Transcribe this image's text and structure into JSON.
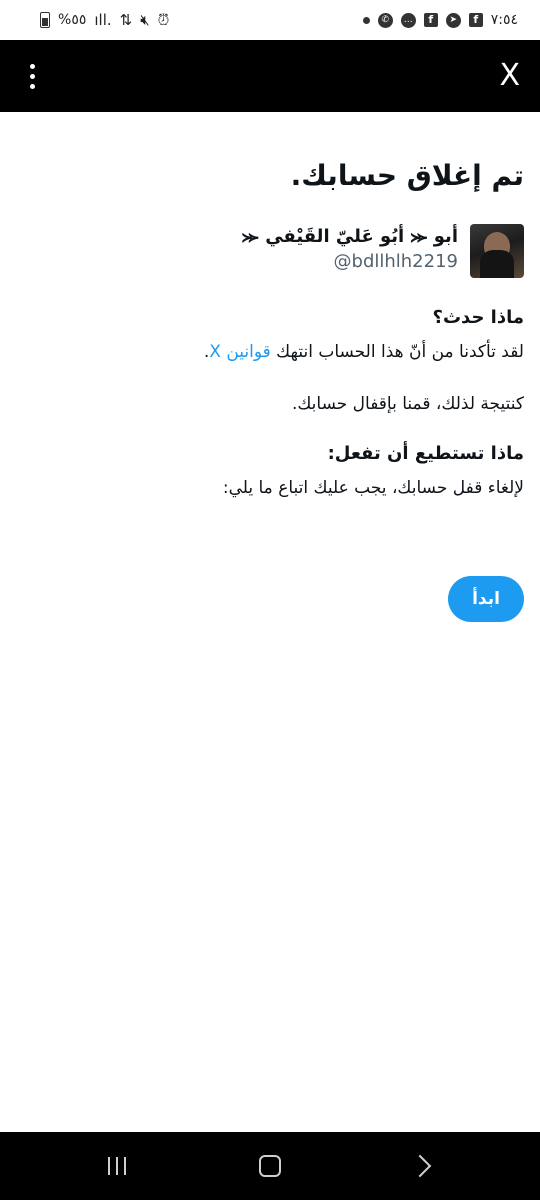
{
  "status_bar": {
    "time": "٧:٥٤",
    "battery": "%٥٥"
  },
  "top_bar": {
    "close_label": "X"
  },
  "main": {
    "title": "تم إغلاق حسابك.",
    "account": {
      "display_name": "أبو ⪻ أبُو عَليّ القَيْفي ⪻",
      "handle": "@bdllhlh2219"
    },
    "what_happened": {
      "heading": "ماذا حدث؟",
      "text_before": "لقد تأكدنا من أنّ هذا الحساب انتهك ",
      "link": "قوانين X",
      "text_after": "."
    },
    "consequence": "كنتيجة لذلك، قمنا بإقفال حسابك.",
    "what_to_do": {
      "heading": "ماذا تستطيع أن تفعل:",
      "text": "لإلغاء قفل حسابك، يجب عليك اتباع ما يلي:"
    },
    "start_button": "ابدأ"
  },
  "colors": {
    "accent": "#1d9bf0",
    "top_bar_bg": "#000000",
    "nav_bar_bg": "#000000",
    "text_primary": "#0f1419",
    "text_secondary": "#536471"
  },
  "icons": {
    "status_left": [
      "battery-icon",
      "signal-icon",
      "data-arrows-icon",
      "mute-icon",
      "alarm-icon"
    ],
    "status_right": [
      "dot-icon",
      "whatsapp-icon",
      "chat-icon",
      "facebook-icon",
      "telegram-icon",
      "facebook-icon"
    ],
    "top_bar": [
      "more-vertical-icon",
      "close-icon"
    ],
    "nav_bar": [
      "recents-icon",
      "home-icon",
      "back-icon"
    ]
  }
}
